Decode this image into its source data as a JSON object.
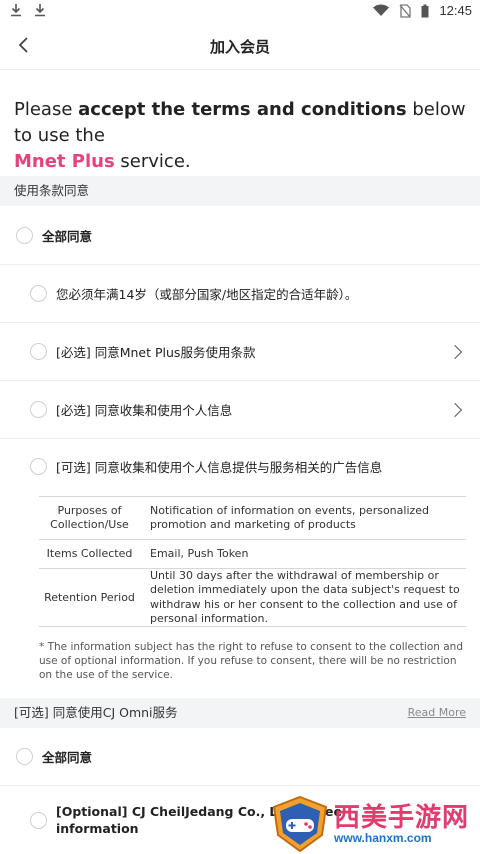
{
  "status": {
    "time": "12:45"
  },
  "header": {
    "title": "加入会员"
  },
  "intro": {
    "part1": "Please ",
    "part2": "accept the terms and conditions",
    "part3": " below to use the ",
    "brand": "Mnet Plus",
    "part4": " service."
  },
  "section1": {
    "title": "使用条款同意"
  },
  "agree_all_1": "全部同意",
  "items": [
    {
      "label": "您必须年满14岁（或部分国家/地区指定的合适年龄）。"
    },
    {
      "label": "[必选] 同意Mnet Plus服务使用条款"
    },
    {
      "label": "[必选] 同意收集和使用个人信息"
    },
    {
      "label": "[可选] 同意收集和使用个人信息提供与服务相关的广告信息"
    }
  ],
  "table": [
    {
      "key": "Purposes of Collection/Use",
      "value": "Notification of information on events, personalized promotion and marketing of products"
    },
    {
      "key": "Items Collected",
      "value": "Email, Push Token"
    },
    {
      "key": "Retention Period",
      "value": "Until 30 days after the withdrawal of membership or deletion immediately upon the data subject's request to withdraw his or her consent to the collection and use of personal information."
    }
  ],
  "note": "* The information subject has the right to refuse to consent to the collection and use of optional information. If you refuse to consent, there will be no restriction on the use of the service.",
  "section2": {
    "title": "[可选] 同意使用CJ Omni服务",
    "more": "Read More"
  },
  "agree_all_2": "全部同意",
  "cj_item": {
    "line1": "[Optional] CJ CheilJedang Co., Ltd. agree",
    "line2": "information"
  },
  "watermark": {
    "text": "西美手游网",
    "url": "www.hanxm.com"
  }
}
